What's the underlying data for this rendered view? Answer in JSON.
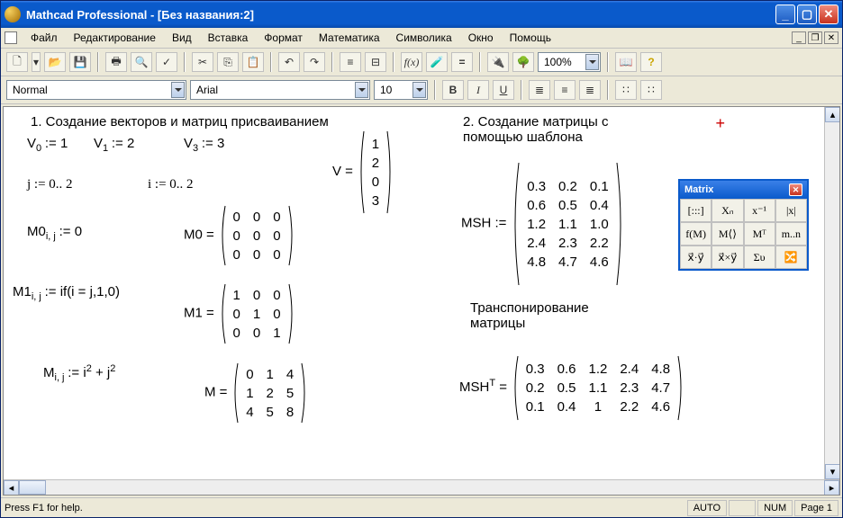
{
  "title": "Mathcad Professional - [Без названия:2]",
  "menu": [
    "Файл",
    "Редактирование",
    "Вид",
    "Вставка",
    "Формат",
    "Математика",
    "Символика",
    "Окно",
    "Помощь"
  ],
  "format_toolbar": {
    "style": "Normal",
    "font": "Arial",
    "size": "10"
  },
  "zoom": "100%",
  "status_help": "Press F1 for help.",
  "status_cells": [
    "AUTO",
    "NUM",
    "Page 1"
  ],
  "palette_title": "Matrix",
  "palette_items": [
    "[:::]",
    "Xₙ",
    "x⁻¹",
    "|x|",
    "f(M)",
    "M⟨⟩",
    "Mᵀ",
    "m..n",
    "x⃗·y⃗",
    "x⃗×y⃗",
    "Συ",
    "🔀"
  ],
  "content": {
    "h1": "1. Создание векторов и матриц присваиванием",
    "h2": "2. Создание матрицы с помощью шаблона",
    "h3": "Транспонирование матрицы",
    "v0": "V",
    "v0sub": "0",
    "v0v": ":= 1",
    "v1": "V",
    "v1sub": "1",
    "v1v": ":= 2",
    "v3": "V",
    "v3sub": "3",
    "v3v": ":= 3",
    "jrange": "j := 0.. 2",
    "irange": "i := 0.. 2",
    "Vlabel": "V =",
    "Vvec": [
      [
        "1"
      ],
      [
        "2"
      ],
      [
        "0"
      ],
      [
        "3"
      ]
    ],
    "M0def": "M0",
    "M0sub": "i, j",
    "M0v": ":= 0",
    "M0label": "M0 =",
    "M0": [
      [
        "0",
        "0",
        "0"
      ],
      [
        "0",
        "0",
        "0"
      ],
      [
        "0",
        "0",
        "0"
      ]
    ],
    "M1def": "M1",
    "M1sub": "i, j",
    "M1v": ":= if(i = j,1,0)",
    "M1label": "M1 =",
    "M1": [
      [
        "1",
        "0",
        "0"
      ],
      [
        "0",
        "1",
        "0"
      ],
      [
        "0",
        "0",
        "1"
      ]
    ],
    "Mdef": "M",
    "Mdefsub": "i, j",
    "Mdefv": ":= i",
    "Mdefv2": " + j",
    "Mlabel": "M =",
    "M": [
      [
        "0",
        "1",
        "4"
      ],
      [
        "1",
        "2",
        "5"
      ],
      [
        "4",
        "5",
        "8"
      ]
    ],
    "MSHlabel": "MSH :=",
    "MSH": [
      [
        "0.3",
        "0.2",
        "0.1"
      ],
      [
        "0.6",
        "0.5",
        "0.4"
      ],
      [
        "1.2",
        "1.1",
        "1.0"
      ],
      [
        "2.4",
        "2.3",
        "2.2"
      ],
      [
        "4.8",
        "4.7",
        "4.6"
      ]
    ],
    "MSHTlabel": "MSH",
    "MSHTsup": "T",
    "MSHTeq": " =",
    "MSHT": [
      [
        "0.3",
        "0.6",
        "1.2",
        "2.4",
        "4.8"
      ],
      [
        "0.2",
        "0.5",
        "1.1",
        "2.3",
        "4.7"
      ],
      [
        "0.1",
        "0.4",
        "1",
        "2.2",
        "4.6"
      ]
    ]
  }
}
